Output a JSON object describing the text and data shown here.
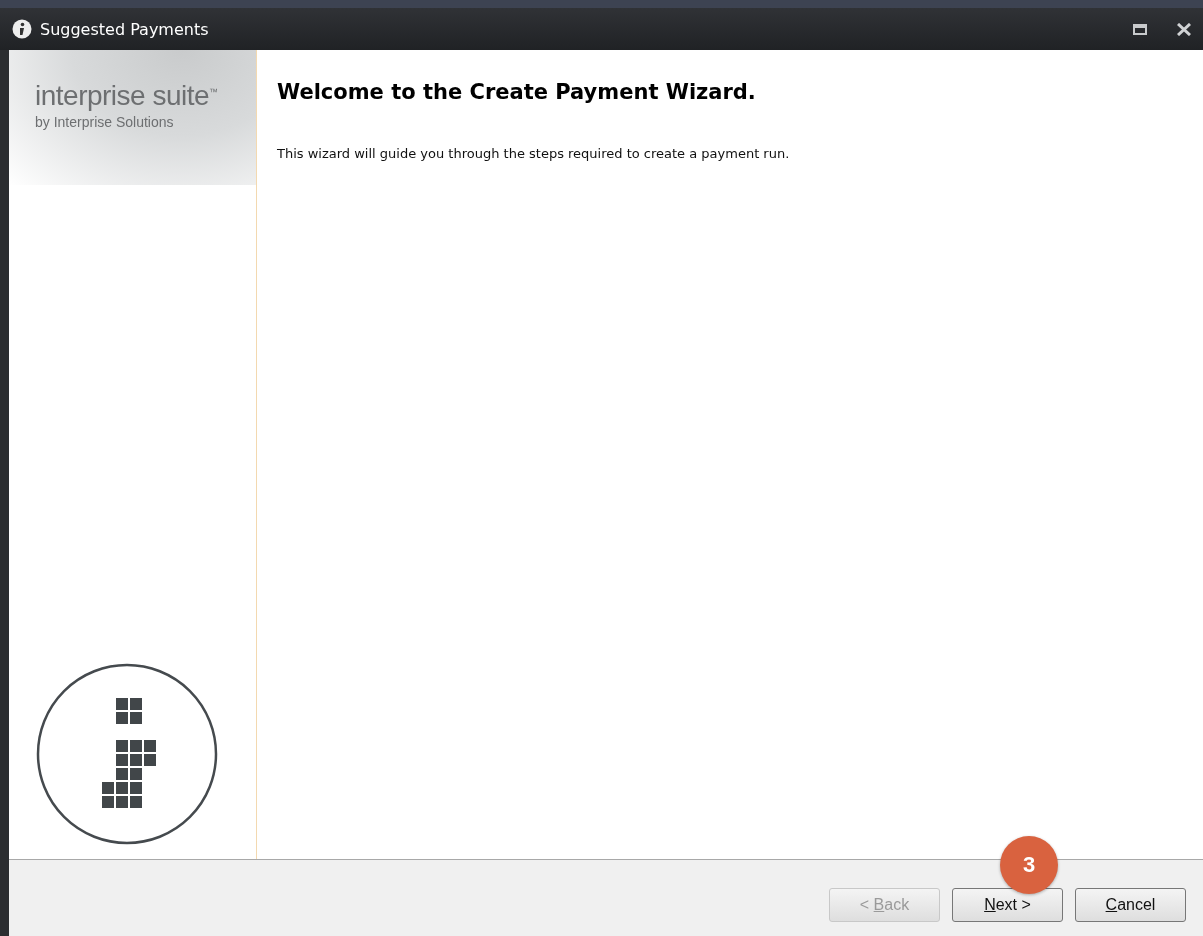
{
  "window": {
    "title": "Suggested Payments"
  },
  "sidebar": {
    "brand": "interprise suite$^{™}$",
    "byline": "by Interprise Solutions"
  },
  "content": {
    "heading": "Welcome to the Create Payment Wizard.",
    "text": "This wizard will guide you through the steps required to create a payment run."
  },
  "step_badge": "3",
  "buttons": [
    {
      "before": "< ",
      "key": "B",
      "after": "ack",
      "disabled": true
    },
    {
      "key": "N",
      "after": "ext >",
      "disabled": false
    },
    {
      "key": "C",
      "after": "ancel",
      "disabled": false
    }
  ]
}
